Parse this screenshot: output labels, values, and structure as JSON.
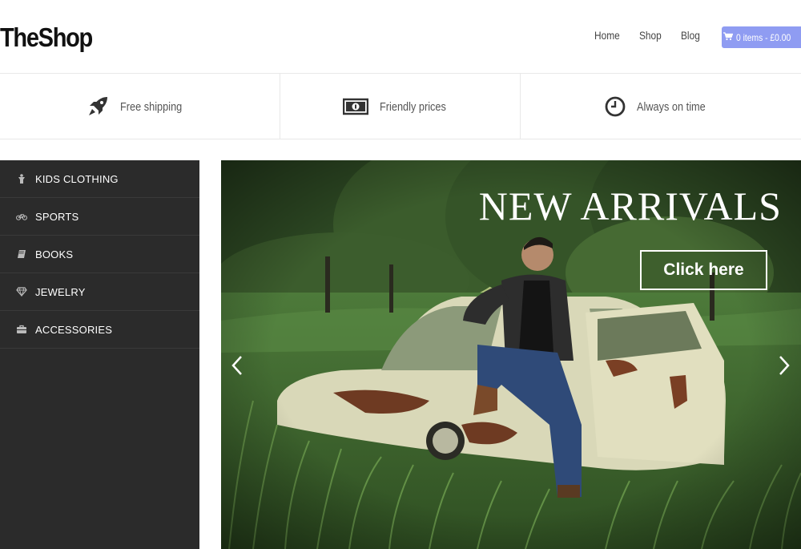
{
  "header": {
    "logo": "TheShop",
    "nav": [
      {
        "label": "Home"
      },
      {
        "label": "Shop"
      },
      {
        "label": "Blog"
      }
    ],
    "cart": {
      "label": "0 items - £0.00",
      "icon": "cart-icon"
    }
  },
  "features": [
    {
      "label": "Free shipping",
      "icon": "rocket-icon"
    },
    {
      "label": "Friendly prices",
      "icon": "banknote-icon"
    },
    {
      "label": "Always on time",
      "icon": "clock-icon"
    }
  ],
  "sidebar": {
    "items": [
      {
        "label": "KIDS CLOTHING",
        "icon": "child-icon"
      },
      {
        "label": "SPORTS",
        "icon": "bicycle-icon"
      },
      {
        "label": "BOOKS",
        "icon": "book-icon"
      },
      {
        "label": "JEWELRY",
        "icon": "diamond-icon"
      },
      {
        "label": "ACCESSORIES",
        "icon": "briefcase-icon"
      }
    ]
  },
  "slider": {
    "headline": "NEW ARRIVALS",
    "cta_label": "Click here"
  },
  "colors": {
    "accent": "#8f9cf2",
    "sidebar_bg": "#2b2b2b"
  }
}
